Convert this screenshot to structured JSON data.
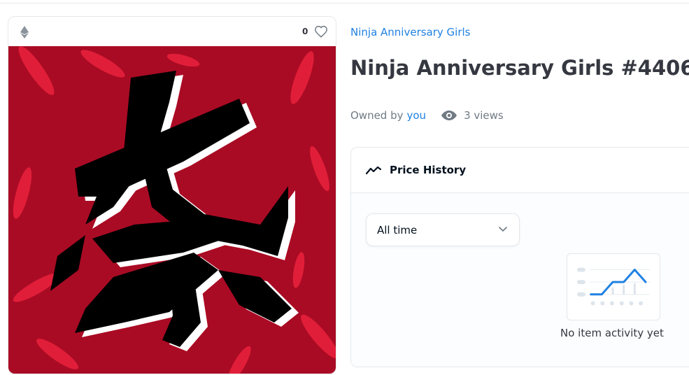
{
  "asset": {
    "favorite_count": "0",
    "collection_name": "Ninja Anniversary Girls",
    "title": "Ninja Anniversary Girls #4406",
    "owned_by_label": "Owned by",
    "owner": "you",
    "views": "3 views"
  },
  "price_history": {
    "title": "Price History",
    "time_filter": "All time",
    "empty_message": "No item activity yet"
  },
  "icons": {
    "chain": "ethereum-icon",
    "favorite": "heart-icon",
    "views": "eye-icon",
    "section": "trend-line-icon",
    "dropdown": "chevron-down-icon"
  },
  "colors": {
    "accent": "#2081e2",
    "artwork_background": "#aa0b24",
    "artwork_feathers": "#e8213d"
  }
}
